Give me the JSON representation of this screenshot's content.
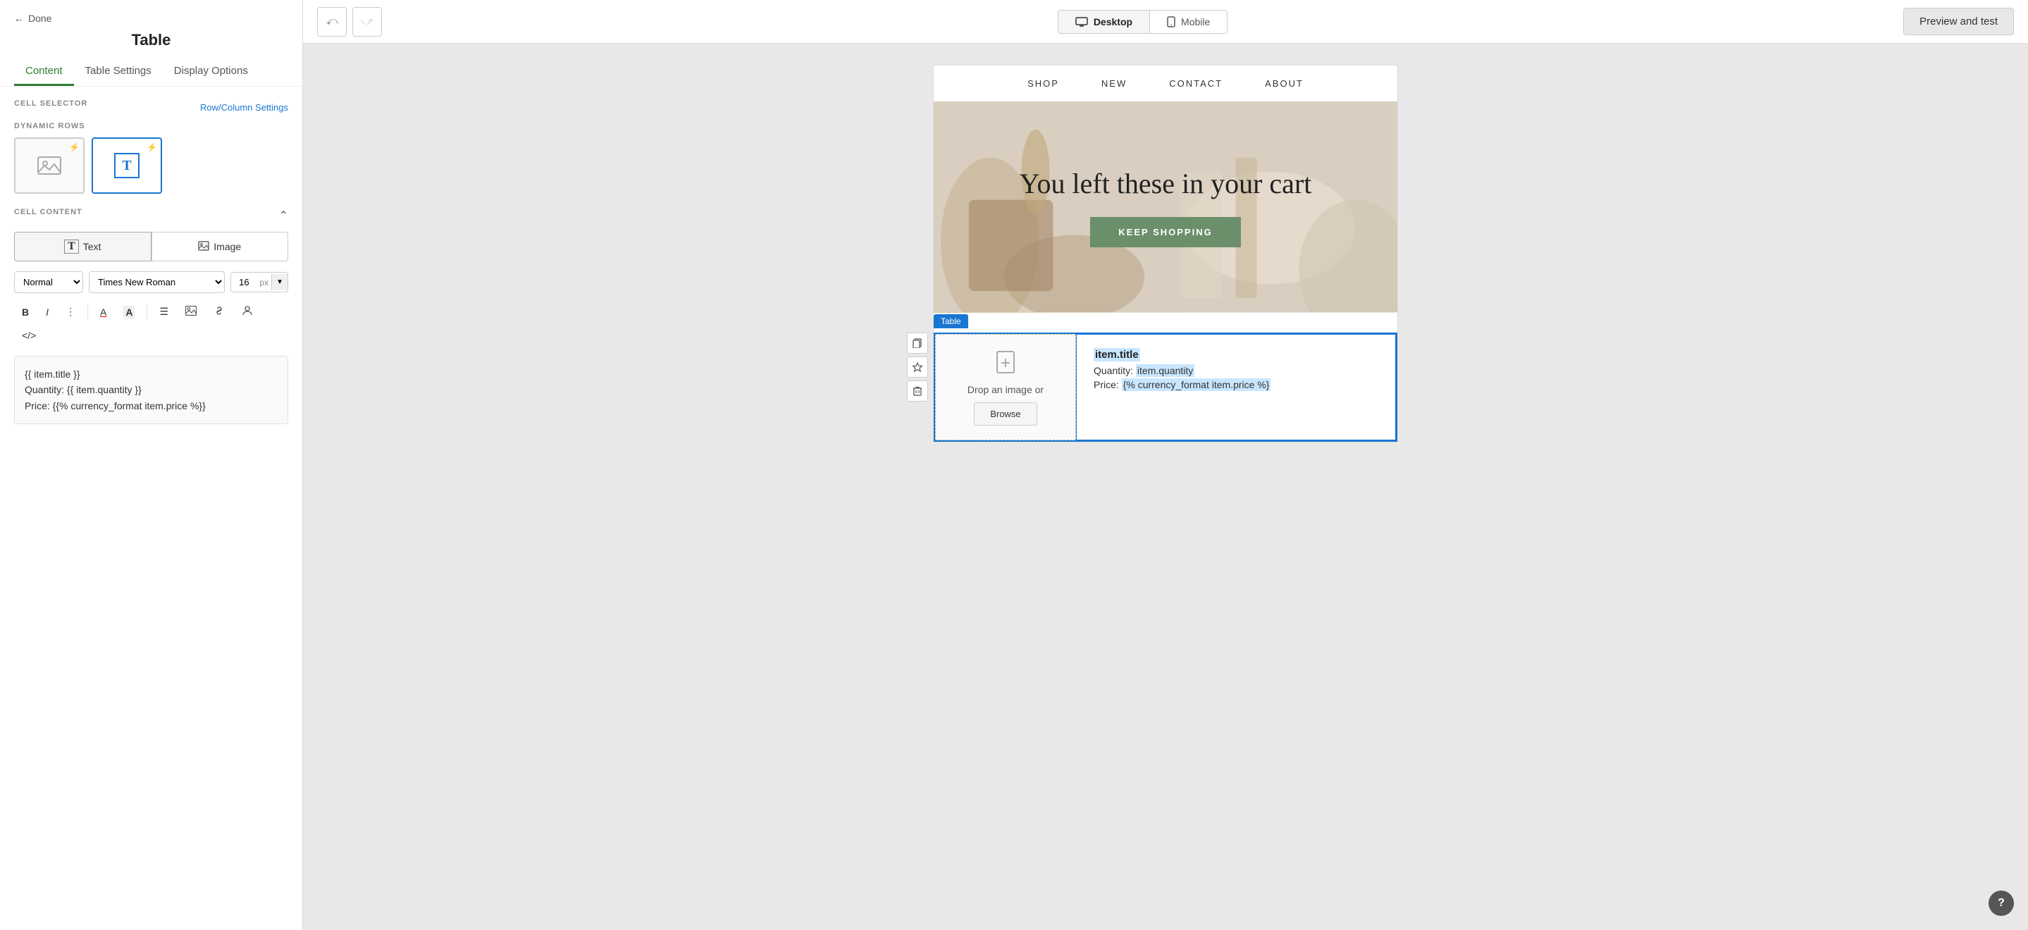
{
  "leftPanel": {
    "backLabel": "Done",
    "title": "Table",
    "tabs": [
      "Content",
      "Table Settings",
      "Display Options"
    ],
    "activeTab": "Content",
    "cellSelector": {
      "label": "CELL SELECTOR",
      "rowColLink": "Row/Column Settings"
    },
    "dynamicRows": {
      "label": "DYNAMIC ROWS",
      "cells": [
        {
          "type": "image",
          "selected": false
        },
        {
          "type": "text",
          "selected": true
        }
      ]
    },
    "cellContent": {
      "label": "CELL CONTENT",
      "textBtnLabel": "Text",
      "imageBtnLabel": "Image",
      "activeType": "Text",
      "fontStyle": "Normal",
      "fontFamily": "Times New Roman",
      "fontSize": "16",
      "fontUnit": "px",
      "textContent": "{{ item.title }}\nQuantity: {{ item.quantity }}\nPrice: {% currency_format item.price %}"
    }
  },
  "toolbar": {
    "undoLabel": "↩",
    "redoLabel": "↪",
    "desktopLabel": "Desktop",
    "mobileLabel": "Mobile",
    "previewLabel": "Preview and test"
  },
  "emailPreview": {
    "nav": [
      "SHOP",
      "NEW",
      "CONTACT",
      "ABOUT"
    ],
    "heroTitle": "You left these in your cart",
    "heroBtn": "KEEP SHOPPING",
    "tableLabel": "Table",
    "imageCell": {
      "dropText": "Drop an image or",
      "browseLabel": "Browse"
    },
    "textCell": {
      "itemTitle": "item.title",
      "quantity": "Quantity: item.quantity",
      "price": "Price: {% currency_format item.price %}"
    }
  },
  "helpBtn": "?"
}
